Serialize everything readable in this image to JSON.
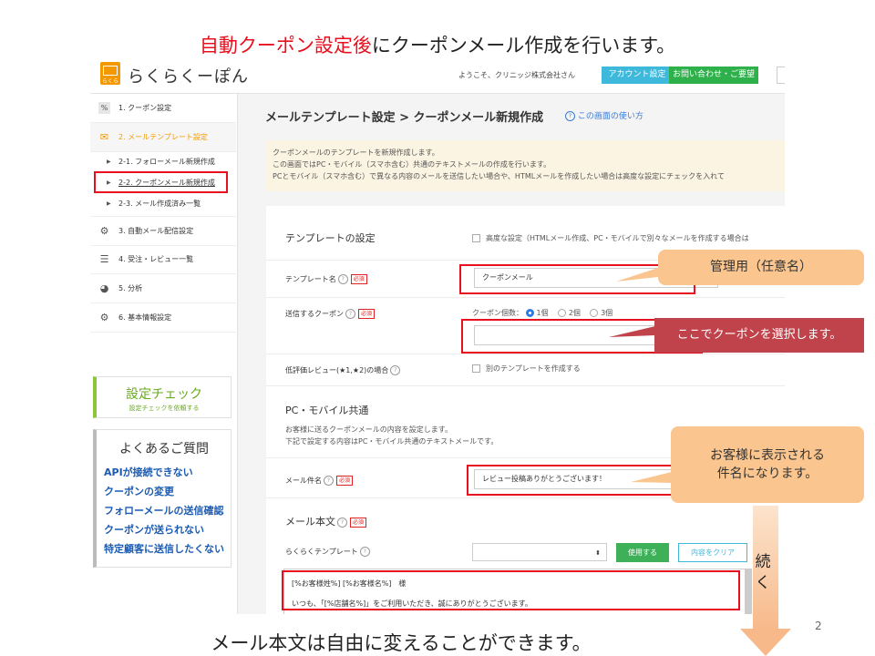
{
  "slide": {
    "title_red": "自動クーポン設定後",
    "title_rest": "にクーポンメール作成を行います。",
    "footer": "メール本文は自由に変えることができます。",
    "page_number": "2",
    "continue_label": "続く"
  },
  "header": {
    "logo_text": "らくらくーぽん",
    "logo_mini": "らくらく",
    "welcome": "ようこそ、クリニッジ株式会社さん",
    "account_button": "アカウント設定",
    "contact_button": "お問い合わせ・ご要望"
  },
  "sidebar": {
    "items": [
      {
        "label": "1. クーポン設定",
        "icon": "percent-icon"
      },
      {
        "label": "2. メールテンプレート設定",
        "icon": "mail-icon"
      },
      {
        "label": "3. 自動メール配信設定",
        "icon": "gears-icon"
      },
      {
        "label": "4. 受注・レビュー一覧",
        "icon": "list-icon"
      },
      {
        "label": "5. 分析",
        "icon": "pie-icon"
      },
      {
        "label": "6. 基本情報設定",
        "icon": "gear-icon"
      }
    ],
    "sub_items": [
      {
        "label": "2-1. フォローメール新規作成"
      },
      {
        "label": "2-2. クーポンメール新規作成"
      },
      {
        "label": "2-3. メール作成済み一覧"
      }
    ],
    "check": {
      "title": "設定チェック",
      "subtitle": "設定チェックを依頼する"
    },
    "faq": {
      "title": "よくあるご質問",
      "links": [
        "APIが接続できない",
        "クーポンの変更",
        "フォローメールの送信確認",
        "クーポンが送られない",
        "特定顧客に送信したくない"
      ]
    }
  },
  "main": {
    "breadcrumb": "メールテンプレート設定 > クーポンメール新規作成",
    "help_link": "この画面の使い方",
    "notice": [
      "クーポンメールのテンプレートを新規作成します。",
      "この画面ではPC・モバイル（スマホ含む）共通のテキストメールの作成を行います。",
      "PCとモバイル（スマホ含む）で異なる内容のメールを送信したい場合や、HTMLメールを作成したい場合は高度な設定にチェックを入れて"
    ],
    "template_settings": {
      "title": "テンプレートの設定",
      "advanced_label": "高度な設定（HTMLメール作成、PC・モバイルで別々なメールを作成する場合は",
      "name_label": "テンプレート名",
      "name_value": "クーポンメール",
      "coupon_label": "送信するクーポン",
      "coupon_count_label": "クーポン個数：",
      "coupon_options": [
        "1個",
        "2個",
        "3個"
      ],
      "low_review_label": "低評価レビュー(★1,★2)の場合",
      "low_review_option": "別のテンプレートを作成する"
    },
    "common": {
      "title": "PC・モバイル共通",
      "desc1": "お客様に送るクーポンメールの内容を設定します。",
      "desc2": "下記で設定する内容はPC・モバイル共通のテキストメールです。",
      "subject_label": "メール件名",
      "subject_value": "レビュー投稿ありがとうございます！",
      "body_label": "メール本文",
      "template_label": "らくらくテンプレート",
      "use_button": "使用する",
      "clear_button": "内容をクリア",
      "body_line1": "[%お客様姓%] [%お客様名%]　様",
      "body_line2": "いつも、「[%店舗名%]」をご利用いただき、誠にありがとうございます。"
    },
    "required_tag": "必須",
    "help_mark": "?"
  },
  "callouts": {
    "name_note": "管理用（任意名）",
    "coupon_note": "ここでクーポンを選択します。",
    "subject_note_line1": "お客様に表示される",
    "subject_note_line2": "件名になります。"
  }
}
